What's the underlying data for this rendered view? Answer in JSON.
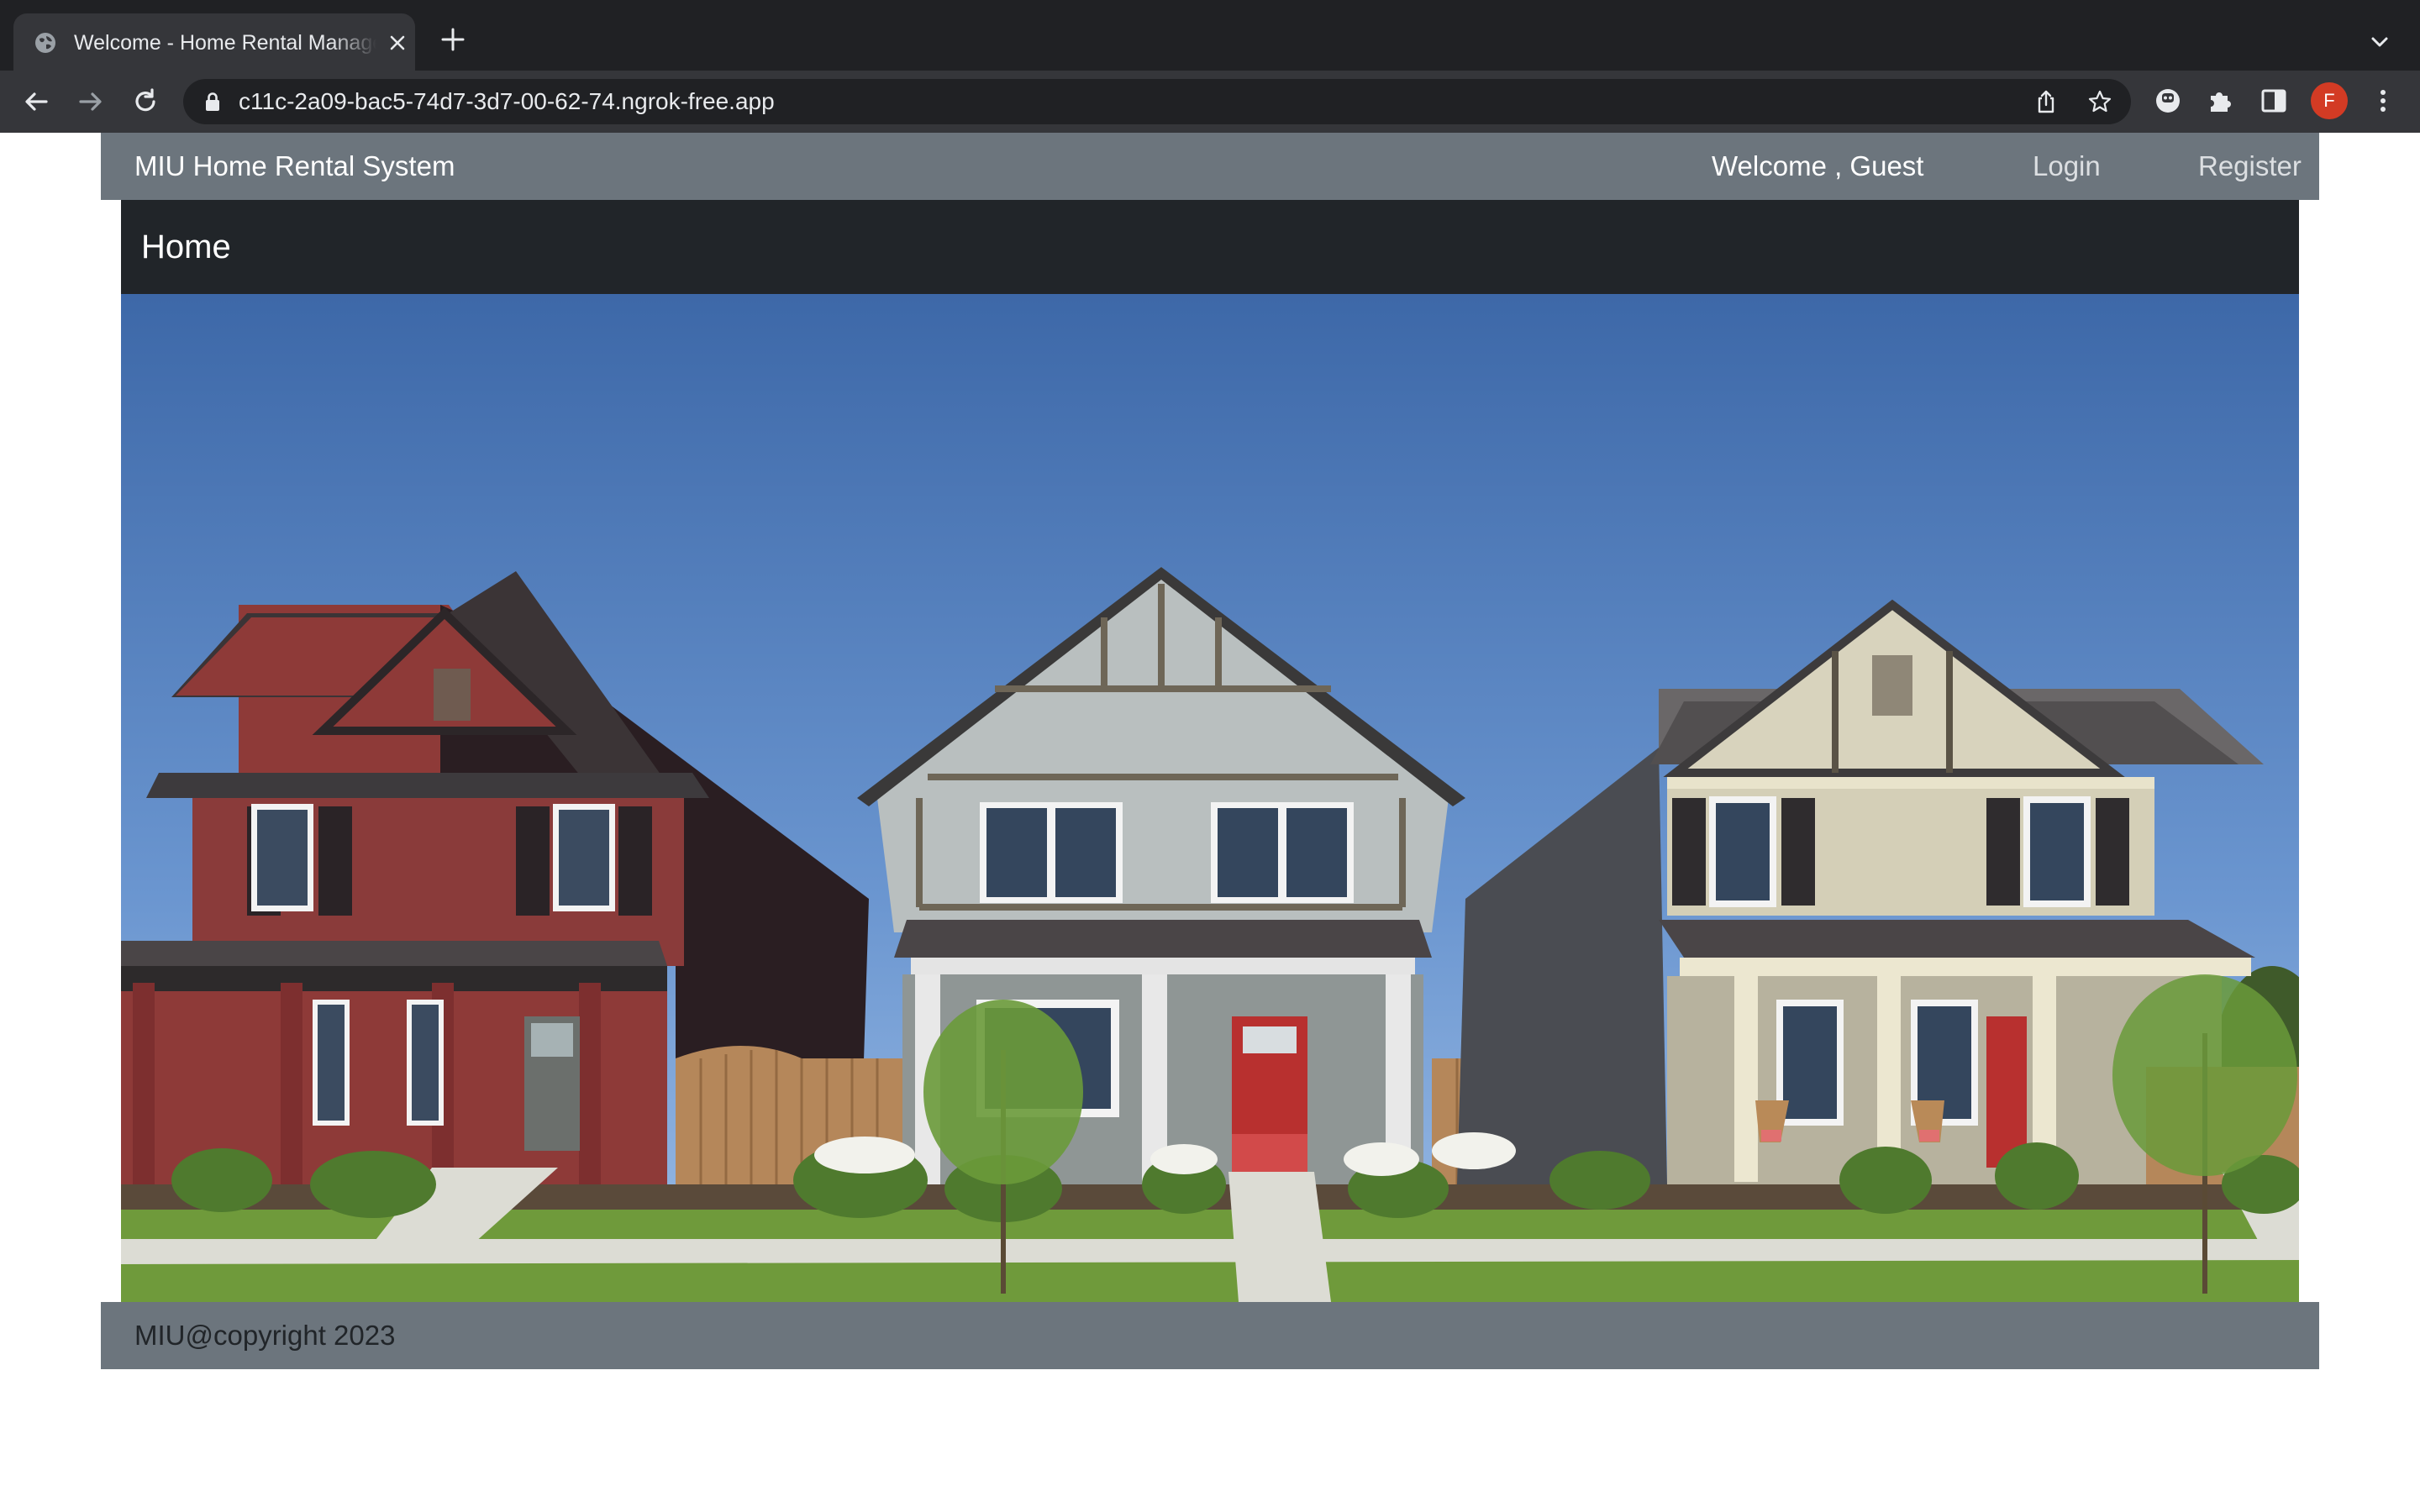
{
  "browser": {
    "tab_title": "Welcome - Home Rental Management",
    "url": "c11c-2a09-bac5-74d7-3d7-00-62-74.ngrok-free.app",
    "profile_initial": "F",
    "icons": [
      "globe-icon",
      "close-icon",
      "plus-icon",
      "chevron-down-icon",
      "back-icon",
      "forward-icon",
      "reload-icon",
      "lock-icon",
      "share-icon",
      "star-icon",
      "extension-icon",
      "puzzle-icon",
      "side-panel-icon",
      "menu-icon"
    ],
    "colors": {
      "frame": "#202124",
      "toolbar": "#35363a",
      "avatar": "#d33b24"
    }
  },
  "navbar": {
    "brand": "MIU Home Rental System",
    "welcome": "Welcome , Guest",
    "login": "Login",
    "register": "Register",
    "color": "#6c757d"
  },
  "header": {
    "title": "Home",
    "color": "#212529"
  },
  "footer": {
    "text": "MIU@copyright 2023"
  }
}
